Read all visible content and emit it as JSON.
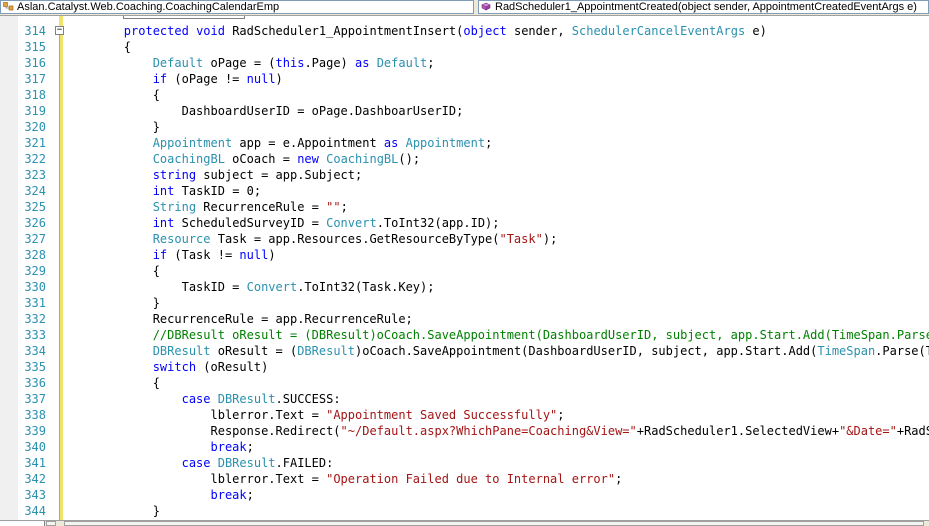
{
  "navigation": {
    "class_combo": "Aslan.Catalyst.Web.Coaching.CoachingCalendarEmp",
    "member_combo": "RadScheduler1_AppointmentCreated(object sender, AppointmentCreatedEventArgs e)"
  },
  "colors": {
    "keyword": "#0000ff",
    "type": "#2b91af",
    "string": "#a31515",
    "comment": "#008000",
    "line_number": "#2b91af"
  },
  "code_lines": [
    {
      "n": "314",
      "segs": [
        {
          "t": "        "
        },
        {
          "t": "protected",
          "c": "kw"
        },
        {
          "t": " "
        },
        {
          "t": "void",
          "c": "kw"
        },
        {
          "t": " RadScheduler1_AppointmentInsert("
        },
        {
          "t": "object",
          "c": "kw"
        },
        {
          "t": " sender, "
        },
        {
          "t": "SchedulerCancelEventArgs",
          "c": "ty"
        },
        {
          "t": " e)"
        }
      ]
    },
    {
      "n": "315",
      "segs": [
        {
          "t": "        {"
        }
      ]
    },
    {
      "n": "316",
      "segs": [
        {
          "t": "            "
        },
        {
          "t": "Default",
          "c": "ty"
        },
        {
          "t": " oPage = ("
        },
        {
          "t": "this",
          "c": "kw"
        },
        {
          "t": ".Page) "
        },
        {
          "t": "as",
          "c": "kw"
        },
        {
          "t": " "
        },
        {
          "t": "Default",
          "c": "ty"
        },
        {
          "t": ";"
        }
      ]
    },
    {
      "n": "317",
      "segs": [
        {
          "t": "            "
        },
        {
          "t": "if",
          "c": "kw"
        },
        {
          "t": " (oPage != "
        },
        {
          "t": "null",
          "c": "kw"
        },
        {
          "t": ")"
        }
      ]
    },
    {
      "n": "318",
      "segs": [
        {
          "t": "            {"
        }
      ]
    },
    {
      "n": "319",
      "segs": [
        {
          "t": "                DashboardUserID = oPage.DashboarUserID;"
        }
      ]
    },
    {
      "n": "320",
      "segs": [
        {
          "t": "            }"
        }
      ]
    },
    {
      "n": "321",
      "segs": [
        {
          "t": "            "
        },
        {
          "t": "Appointment",
          "c": "ty"
        },
        {
          "t": " app = e.Appointment "
        },
        {
          "t": "as",
          "c": "kw"
        },
        {
          "t": " "
        },
        {
          "t": "Appointment",
          "c": "ty"
        },
        {
          "t": ";"
        }
      ]
    },
    {
      "n": "322",
      "segs": [
        {
          "t": "            "
        },
        {
          "t": "CoachingBL",
          "c": "ty"
        },
        {
          "t": " oCoach = "
        },
        {
          "t": "new",
          "c": "kw"
        },
        {
          "t": " "
        },
        {
          "t": "CoachingBL",
          "c": "ty"
        },
        {
          "t": "();"
        }
      ]
    },
    {
      "n": "323",
      "segs": [
        {
          "t": "            "
        },
        {
          "t": "string",
          "c": "kw"
        },
        {
          "t": " subject = app.Subject;"
        }
      ]
    },
    {
      "n": "324",
      "segs": [
        {
          "t": "            "
        },
        {
          "t": "int",
          "c": "kw"
        },
        {
          "t": " TaskID = 0;"
        }
      ]
    },
    {
      "n": "325",
      "segs": [
        {
          "t": "            "
        },
        {
          "t": "String",
          "c": "ty"
        },
        {
          "t": " RecurrenceRule = "
        },
        {
          "t": "\"\"",
          "c": "st"
        },
        {
          "t": ";"
        }
      ]
    },
    {
      "n": "326",
      "segs": [
        {
          "t": "            "
        },
        {
          "t": "int",
          "c": "kw"
        },
        {
          "t": " ScheduledSurveyID = "
        },
        {
          "t": "Convert",
          "c": "ty"
        },
        {
          "t": ".ToInt32(app.ID);"
        }
      ]
    },
    {
      "n": "327",
      "segs": [
        {
          "t": "            "
        },
        {
          "t": "Resource",
          "c": "ty"
        },
        {
          "t": " Task = app.Resources.GetResourceByType("
        },
        {
          "t": "\"Task\"",
          "c": "st"
        },
        {
          "t": ");"
        }
      ]
    },
    {
      "n": "328",
      "segs": [
        {
          "t": "            "
        },
        {
          "t": "if",
          "c": "kw"
        },
        {
          "t": " (Task != "
        },
        {
          "t": "null",
          "c": "kw"
        },
        {
          "t": ")"
        }
      ]
    },
    {
      "n": "329",
      "segs": [
        {
          "t": "            {"
        }
      ]
    },
    {
      "n": "330",
      "segs": [
        {
          "t": "                TaskID = "
        },
        {
          "t": "Convert",
          "c": "ty"
        },
        {
          "t": ".ToInt32(Task.Key);"
        }
      ]
    },
    {
      "n": "331",
      "segs": [
        {
          "t": "            }"
        }
      ]
    },
    {
      "n": "332",
      "segs": [
        {
          "t": "            RecurrenceRule = app.RecurrenceRule;"
        }
      ]
    },
    {
      "n": "333",
      "segs": [
        {
          "t": "            "
        },
        {
          "t": "//DBResult oResult = (DBResult)oCoach.SaveAppointment(DashboardUserID, subject, app.Start.Add(TimeSpan.Parse(Tim",
          "c": "cm"
        }
      ]
    },
    {
      "n": "334",
      "segs": [
        {
          "t": "            "
        },
        {
          "t": "DBResult",
          "c": "ty"
        },
        {
          "t": " oResult = ("
        },
        {
          "t": "DBResult",
          "c": "ty"
        },
        {
          "t": ")oCoach.SaveAppointment(DashboardUserID, subject, app.Start.Add("
        },
        {
          "t": "TimeSpan",
          "c": "ty"
        },
        {
          "t": ".Parse(TimeC"
        }
      ]
    },
    {
      "n": "335",
      "segs": [
        {
          "t": "            "
        },
        {
          "t": "switch",
          "c": "kw"
        },
        {
          "t": " (oResult)"
        }
      ]
    },
    {
      "n": "336",
      "segs": [
        {
          "t": "            {"
        }
      ]
    },
    {
      "n": "337",
      "segs": [
        {
          "t": "                "
        },
        {
          "t": "case",
          "c": "kw"
        },
        {
          "t": " "
        },
        {
          "t": "DBResult",
          "c": "ty"
        },
        {
          "t": ".SUCCESS:"
        }
      ]
    },
    {
      "n": "338",
      "segs": [
        {
          "t": "                    lblerror.Text = "
        },
        {
          "t": "\"Appointment Saved Successfully\"",
          "c": "st"
        },
        {
          "t": ";"
        }
      ]
    },
    {
      "n": "339",
      "segs": [
        {
          "t": "                    Response.Redirect("
        },
        {
          "t": "\"~/Default.aspx?WhichPane=Coaching&View=\"",
          "c": "st"
        },
        {
          "t": "+RadScheduler1.SelectedView+"
        },
        {
          "t": "\"&Date=\"",
          "c": "st"
        },
        {
          "t": "+RadSched"
        }
      ]
    },
    {
      "n": "340",
      "segs": [
        {
          "t": "                    "
        },
        {
          "t": "break",
          "c": "kw"
        },
        {
          "t": ";"
        }
      ]
    },
    {
      "n": "341",
      "segs": [
        {
          "t": "                "
        },
        {
          "t": "case",
          "c": "kw"
        },
        {
          "t": " "
        },
        {
          "t": "DBResult",
          "c": "ty"
        },
        {
          "t": ".FAILED:"
        }
      ]
    },
    {
      "n": "342",
      "segs": [
        {
          "t": "                    lblerror.Text = "
        },
        {
          "t": "\"Operation Failed due to Internal error\"",
          "c": "st"
        },
        {
          "t": ";"
        }
      ]
    },
    {
      "n": "343",
      "segs": [
        {
          "t": "                    "
        },
        {
          "t": "break",
          "c": "kw"
        },
        {
          "t": ";"
        }
      ]
    },
    {
      "n": "344",
      "segs": [
        {
          "t": "            }"
        }
      ]
    }
  ]
}
